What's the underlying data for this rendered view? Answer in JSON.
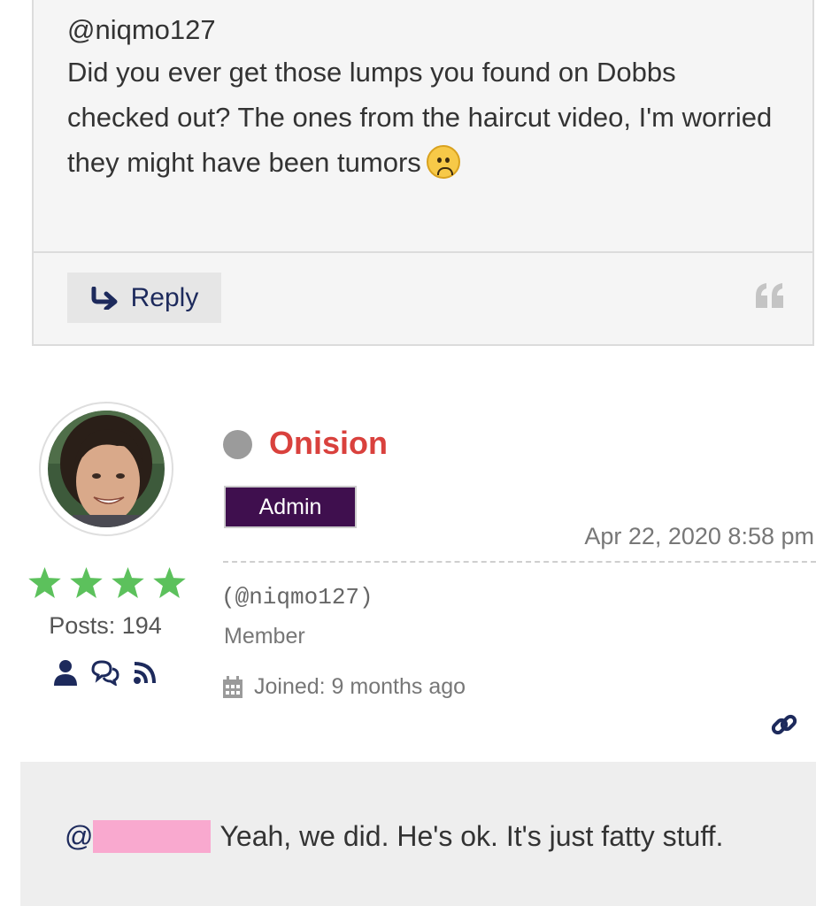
{
  "quoted_post": {
    "mention": "@niqmo127",
    "text": "Did you ever get those lumps you found on Dobbs checked out? The ones from the haircut video, I'm worried they might have been tumors",
    "emoji": "slightly-frowning-face",
    "reply_label": "Reply"
  },
  "author": {
    "name": "Onision",
    "status": "offline",
    "role": "Admin",
    "stars": 4,
    "posts_label": "Posts: 194",
    "icons": [
      "user-icon",
      "chat-bubbles-icon",
      "rss-icon"
    ]
  },
  "post": {
    "date": "Apr 22, 2020 8:58 pm",
    "handle": "(@niqmo127)",
    "member_label": "Member",
    "joined": "Joined: 9 months ago",
    "reply_at": "@",
    "reply_text": "Yeah, we did. He's ok. It's just fatty stuff."
  },
  "colors": {
    "author_name": "#d9413d",
    "role_badge": "#3f0f4e",
    "star": "#5cc15c",
    "icon_navy": "#1d2a5c",
    "redaction": "#f9a9cf"
  }
}
